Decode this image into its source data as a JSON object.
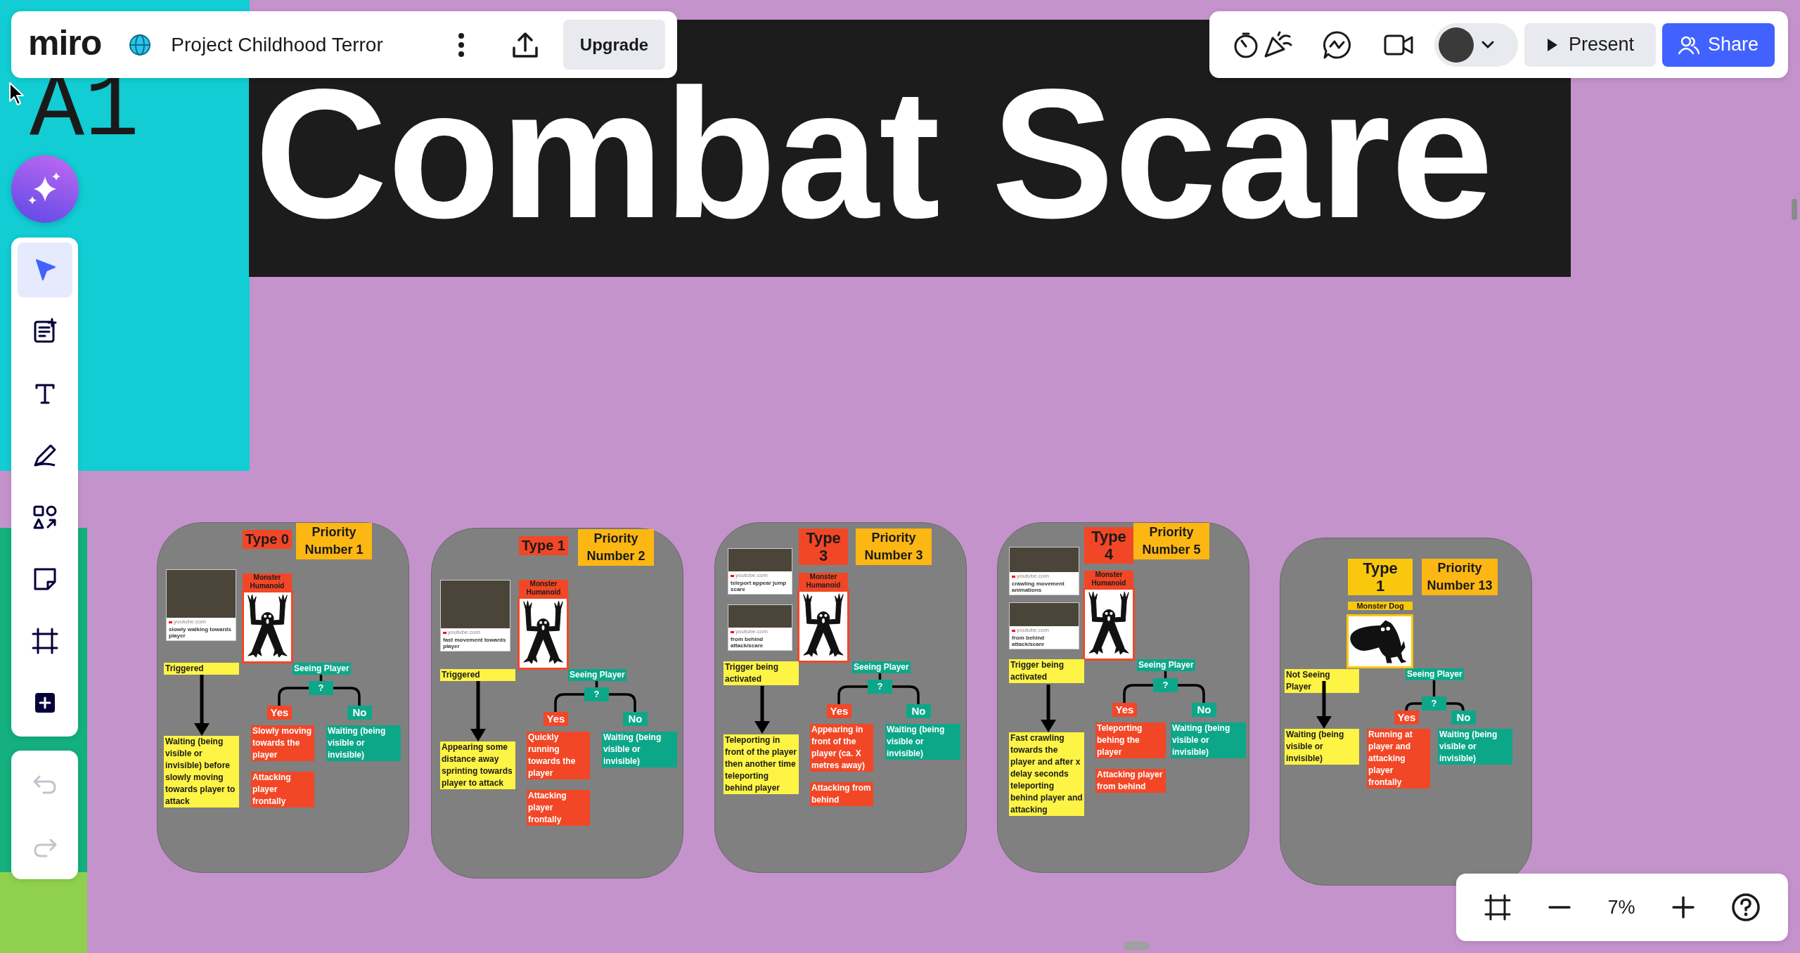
{
  "board": {
    "logo": "miro",
    "title": "Project Childhood Terror",
    "upgrade": "Upgrade"
  },
  "collab": {
    "present": "Present",
    "share": "Share"
  },
  "tools": [
    {
      "kind": "select",
      "selected": true
    },
    {
      "kind": "templates",
      "selected": false
    },
    {
      "kind": "text",
      "selected": false
    },
    {
      "kind": "pen",
      "selected": false
    },
    {
      "kind": "shapes",
      "selected": false
    },
    {
      "kind": "sticky",
      "selected": false
    },
    {
      "kind": "frame",
      "selected": false
    },
    {
      "kind": "more",
      "selected": false
    }
  ],
  "history": [
    {
      "kind": "undo",
      "disabled": true
    },
    {
      "kind": "redo",
      "disabled": true
    }
  ],
  "zoom": {
    "level_text": "7%"
  },
  "canvas": {
    "side_text": [
      "A1"
    ],
    "banner": "Combat Scare",
    "cards": [
      {
        "type_label": {
          "text": "Type 0",
          "color": "#f24726"
        },
        "priority": "Priority Number 1",
        "clips": [
          {
            "source": "youtube.com",
            "caption": "slowly walking towards player"
          }
        ],
        "monster": {
          "label": "Monster Humanoid",
          "kind": "humanoid",
          "color": "#f24726"
        },
        "trigger": {
          "label": "Triggered",
          "result": "Waiting (being visible or invisible) before slowly moving towards player to attack"
        },
        "condition": {
          "label": "Seeing Player",
          "question": "?"
        },
        "yes": {
          "label": "Yes",
          "results": [
            "Slowly moving towards the player",
            "Attacking player frontally"
          ]
        },
        "no": {
          "label": "No",
          "results": [
            "Waiting (being visible or invisible)"
          ]
        }
      },
      {
        "type_label": {
          "text": "Type 1",
          "color": "#f24726"
        },
        "priority": "Priority Number 2",
        "clips": [
          {
            "source": "youtube.com",
            "caption": "fast movement towards player"
          }
        ],
        "monster": {
          "label": "Monster Humanoid",
          "kind": "humanoid",
          "color": "#f24726"
        },
        "trigger": {
          "label": "Triggered",
          "result": "Appearing some distance away sprinting towards player to attack"
        },
        "condition": {
          "label": "Seeing Player",
          "question": "?"
        },
        "yes": {
          "label": "Yes",
          "results": [
            "Quickly running towards the player",
            "Attacking player frontally"
          ]
        },
        "no": {
          "label": "No",
          "results": [
            "Waiting (being visible or invisible)"
          ]
        }
      },
      {
        "type_label": {
          "text": "Type 3",
          "color": "#f24726"
        },
        "priority": "Priority Number 3",
        "clips": [
          {
            "source": "youtube.com",
            "caption": "teleport appear jump scare"
          },
          {
            "source": "youtube.com",
            "caption": "from behind attack/scare"
          }
        ],
        "monster": {
          "label": "Monster Humanoid",
          "kind": "humanoid",
          "color": "#f24726"
        },
        "trigger": {
          "label": "Trigger being activated",
          "result": "Teleporting in front of the player then another time teleporting behind player"
        },
        "condition": {
          "label": "Seeing Player",
          "question": "?"
        },
        "yes": {
          "label": "Yes",
          "results": [
            "Appearing in front of the player (ca. X metres away)",
            "Attacking from behind"
          ]
        },
        "no": {
          "label": "No",
          "results": [
            "Waiting (being visible or invisible)"
          ]
        }
      },
      {
        "type_label": {
          "text": "Type 4",
          "color": "#f24726"
        },
        "priority": "Priority Number 5",
        "clips": [
          {
            "source": "youtube.com",
            "caption": "crawling movement animations"
          },
          {
            "source": "youtube.com",
            "caption": "from behind attack/scare"
          }
        ],
        "monster": {
          "label": "Monster Humanoid",
          "kind": "humanoid",
          "color": "#f24726"
        },
        "trigger": {
          "label": "Trigger being activated",
          "result": "Fast crawling towards the player and after x delay seconds teleporting behind player and attacking"
        },
        "condition": {
          "label": "Seeing Player",
          "question": "?"
        },
        "yes": {
          "label": "Yes",
          "results": [
            "Teleporting behing the player",
            "Attacking player from behind"
          ]
        },
        "no": {
          "label": "No",
          "results": [
            "Waiting (being visible or invisible)"
          ]
        }
      },
      {
        "type_label": {
          "text": "Type 1",
          "color": "#f9c80e"
        },
        "priority": "Priority Number 13",
        "monster": {
          "label": "Monster Dog",
          "kind": "dog",
          "color": "#f9c80e"
        },
        "trigger": {
          "label": "Not Seeing Player",
          "result": "Waiting (being visible or invisible)"
        },
        "condition": {
          "label": "Seeing Player",
          "question": "?"
        },
        "yes": {
          "label": "Yes",
          "results": [
            "Running at player and attacking player frontally"
          ]
        },
        "no": {
          "label": "No",
          "results": [
            "Waiting (being visible or invisible)"
          ]
        }
      }
    ]
  }
}
